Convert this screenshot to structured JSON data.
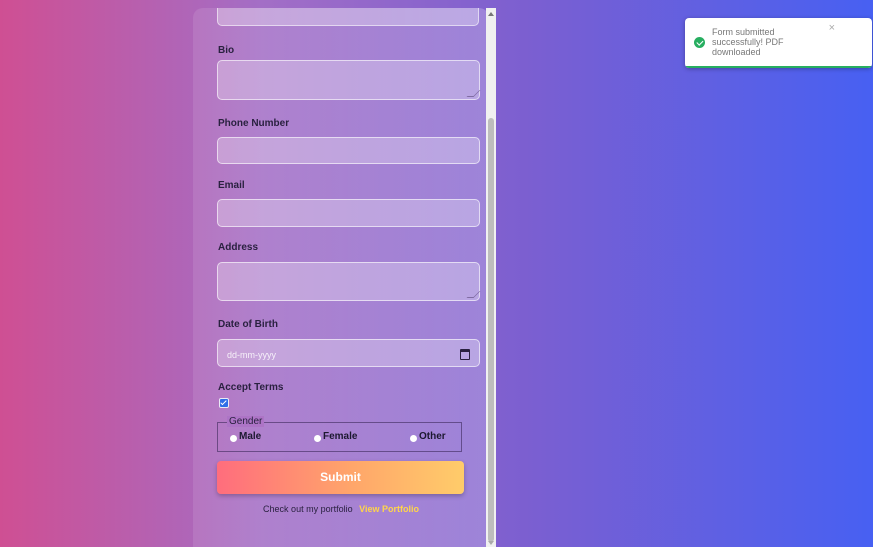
{
  "form": {
    "fields": {
      "bio": {
        "label": "Bio",
        "value": ""
      },
      "phone": {
        "label": "Phone Number",
        "value": ""
      },
      "email": {
        "label": "Email",
        "value": ""
      },
      "address": {
        "label": "Address",
        "value": ""
      },
      "dob": {
        "label": "Date of Birth",
        "placeholder": "dd-mm-yyyy"
      }
    },
    "terms": {
      "label": "Accept Terms",
      "checked": true
    },
    "gender": {
      "legend": "Gender",
      "options": [
        "Male",
        "Female",
        "Other"
      ]
    },
    "submit_label": "Submit",
    "portfolio": {
      "text": "Check out my portfolio",
      "link_label": "View Portfolio"
    }
  },
  "toast": {
    "message": "Form submitted successfully! PDF downloaded",
    "close_glyph": "×",
    "status_color": "#27ae60"
  },
  "icons": [
    "calendar-icon",
    "success-check-icon",
    "close-icon",
    "scroll-up-icon",
    "scroll-down-icon"
  ]
}
